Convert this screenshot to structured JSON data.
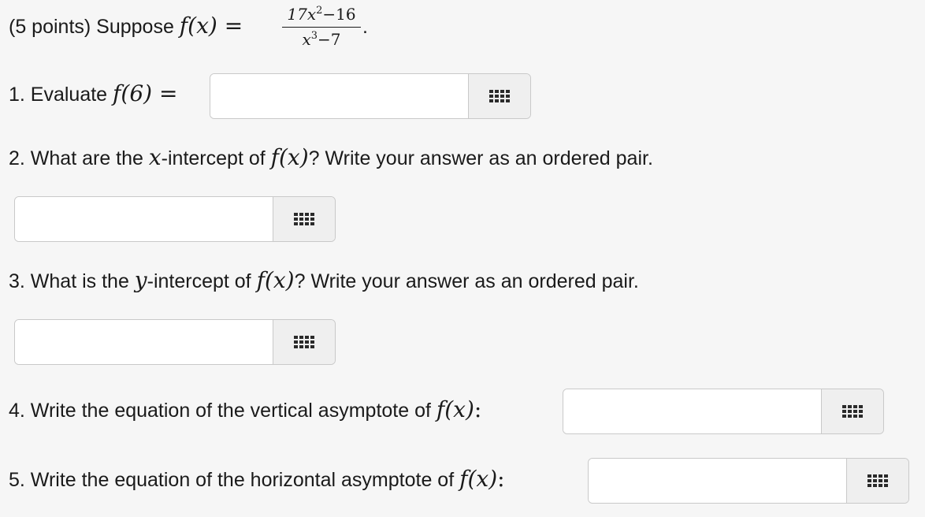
{
  "intro": {
    "prefix": "(5 points) Suppose ",
    "func": "f(x)",
    "eq": " = ",
    "numerator": "17x",
    "num_exp": "2",
    "num_tail": "−16",
    "denominator": "x",
    "den_exp": "3",
    "den_tail": "−7",
    "period": "."
  },
  "q1": {
    "prefix": "1. Evaluate ",
    "expr": "f(6)",
    "eq": " =",
    "input_value": ""
  },
  "q2": {
    "prefix": "2. What are the ",
    "var": "x",
    "mid": "-intercept of ",
    "func": "f(x)",
    "suffix": "? Write your answer as an ordered pair.",
    "input_value": ""
  },
  "q3": {
    "prefix": "3. What is the ",
    "var": "y",
    "mid": "-intercept of ",
    "func": "f(x)",
    "suffix": "? Write your answer as an ordered pair.",
    "input_value": ""
  },
  "q4": {
    "prefix": "4. Write the equation of the vertical asymptote of ",
    "func": "f(x)",
    "suffix": ":",
    "input_value": ""
  },
  "q5": {
    "prefix": "5. Write the equation of the horizontal asymptote of ",
    "func": "f(x)",
    "suffix": ":",
    "input_value": ""
  },
  "icons": {
    "keyboard": "grid-keypad-icon"
  }
}
